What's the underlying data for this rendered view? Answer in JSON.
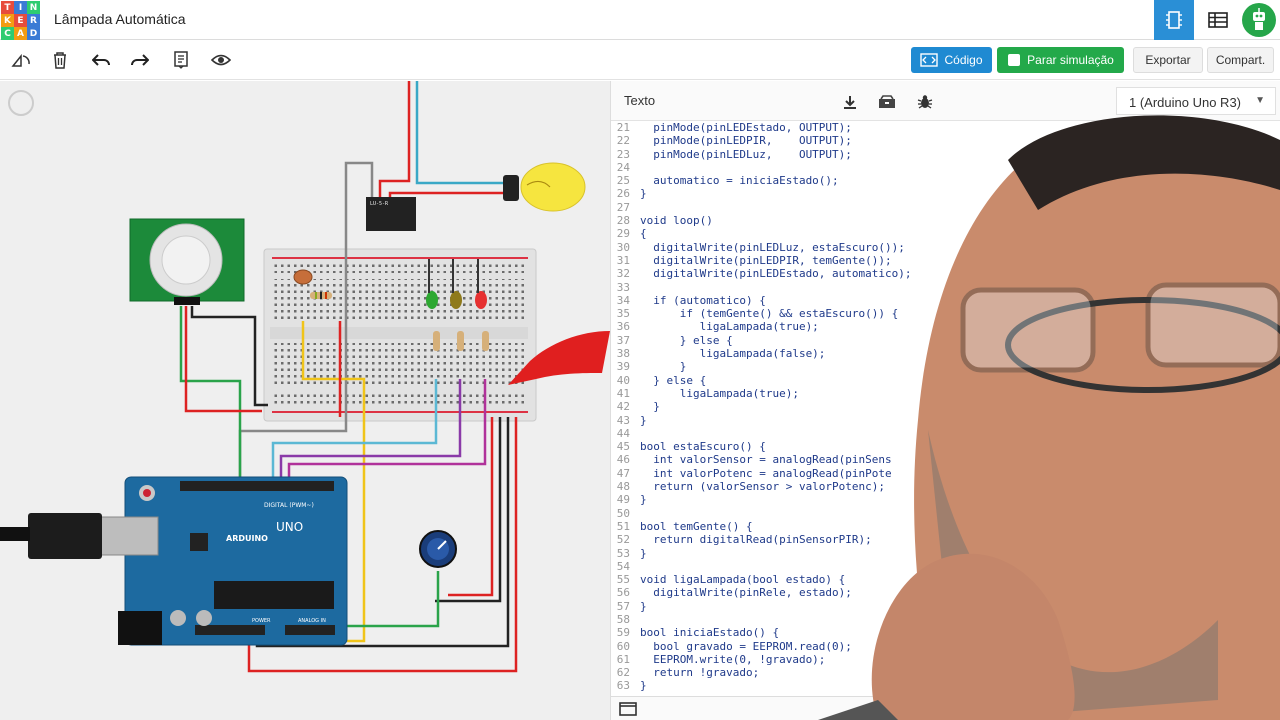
{
  "app": {
    "logo_letters": [
      "T",
      "I",
      "N",
      "K",
      "E",
      "R",
      "C",
      "A",
      "D"
    ],
    "logo_colors": [
      "#e74c3c",
      "#3a7bd5",
      "#2ecc71",
      "#f39c12",
      "#e74c3c",
      "#3a7bd5",
      "#2ecc71",
      "#f39c12",
      "#3a7bd5"
    ],
    "title": "Lâmpada Automática"
  },
  "toolbar": {
    "code_label": "Código",
    "sim_label": "Parar simulação",
    "export_label": "Exportar",
    "share_label": "Compart."
  },
  "panel": {
    "title": "Texto",
    "device": "1 (Arduino Uno R3)"
  },
  "breadboard": {
    "relay_text": "LU-5-R"
  },
  "arduino": {
    "brand": "ARDUINO",
    "model": "UNO",
    "digital": "DIGITAL (PWM~)",
    "power": "POWER",
    "analog": "ANALOG IN"
  },
  "code_lines": [
    {
      "n": "21",
      "t": "  pinMode(pinLEDEstado, OUTPUT);"
    },
    {
      "n": "22",
      "t": "  pinMode(pinLEDPIR,    OUTPUT);"
    },
    {
      "n": "23",
      "t": "  pinMode(pinLEDLuz,    OUTPUT);"
    },
    {
      "n": "24",
      "t": ""
    },
    {
      "n": "25",
      "t": "  automatico = iniciaEstado();"
    },
    {
      "n": "26",
      "t": "}"
    },
    {
      "n": "27",
      "t": ""
    },
    {
      "n": "28",
      "t": "void loop()"
    },
    {
      "n": "29",
      "t": "{"
    },
    {
      "n": "30",
      "t": "  digitalWrite(pinLEDLuz, estaEscuro());"
    },
    {
      "n": "31",
      "t": "  digitalWrite(pinLEDPIR, temGente());"
    },
    {
      "n": "32",
      "t": "  digitalWrite(pinLEDEstado, automatico);"
    },
    {
      "n": "33",
      "t": ""
    },
    {
      "n": "34",
      "t": "  if (automatico) {"
    },
    {
      "n": "35",
      "t": "      if (temGente() && estaEscuro()) {"
    },
    {
      "n": "36",
      "t": "         ligaLampada(true);"
    },
    {
      "n": "37",
      "t": "      } else {"
    },
    {
      "n": "38",
      "t": "         ligaLampada(false);"
    },
    {
      "n": "39",
      "t": "      }"
    },
    {
      "n": "40",
      "t": "  } else {"
    },
    {
      "n": "41",
      "t": "      ligaLampada(true);"
    },
    {
      "n": "42",
      "t": "  }"
    },
    {
      "n": "43",
      "t": "}"
    },
    {
      "n": "44",
      "t": ""
    },
    {
      "n": "45",
      "t": "bool estaEscuro() {"
    },
    {
      "n": "46",
      "t": "  int valorSensor = analogRead(pinSens"
    },
    {
      "n": "47",
      "t": "  int valorPotenc = analogRead(pinPote"
    },
    {
      "n": "48",
      "t": "  return (valorSensor > valorPotenc);"
    },
    {
      "n": "49",
      "t": "}"
    },
    {
      "n": "50",
      "t": ""
    },
    {
      "n": "51",
      "t": "bool temGente() {"
    },
    {
      "n": "52",
      "t": "  return digitalRead(pinSensorPIR);"
    },
    {
      "n": "53",
      "t": "}"
    },
    {
      "n": "54",
      "t": ""
    },
    {
      "n": "55",
      "t": "void ligaLampada(bool estado) {"
    },
    {
      "n": "56",
      "t": "  digitalWrite(pinRele, estado);"
    },
    {
      "n": "57",
      "t": "}"
    },
    {
      "n": "58",
      "t": ""
    },
    {
      "n": "59",
      "t": "bool iniciaEstado() {"
    },
    {
      "n": "60",
      "t": "  bool gravado = EEPROM.read(0);"
    },
    {
      "n": "61",
      "t": "  EEPROM.write(0, !gravado);"
    },
    {
      "n": "62",
      "t": "  return !gravado;"
    },
    {
      "n": "63",
      "t": "}"
    }
  ]
}
